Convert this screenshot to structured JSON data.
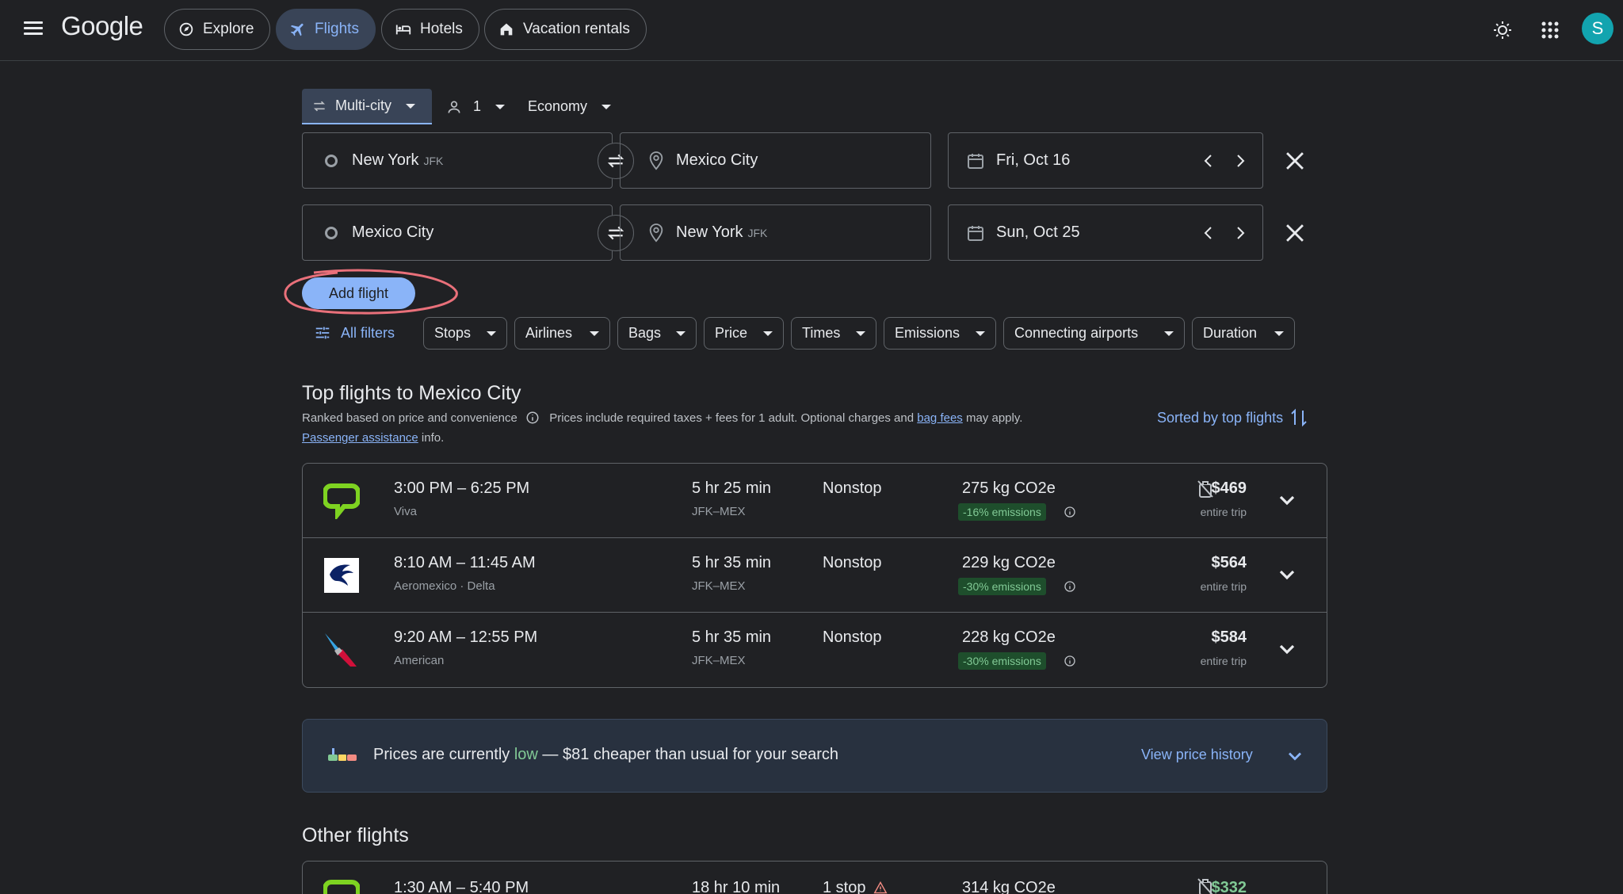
{
  "header": {
    "logo": "Google",
    "nav": [
      {
        "label": "Explore",
        "icon": "explore-icon"
      },
      {
        "label": "Flights",
        "icon": "plane-icon",
        "active": true
      },
      {
        "label": "Hotels",
        "icon": "bed-icon"
      },
      {
        "label": "Vacation rentals",
        "icon": "house-icon"
      }
    ],
    "avatar_initial": "S"
  },
  "search": {
    "trip_type": "Multi-city",
    "passengers": "1",
    "cabin": "Economy",
    "legs": [
      {
        "from": "New York",
        "from_code": "JFK",
        "to": "Mexico City",
        "to_code": "",
        "date": "Fri, Oct 16"
      },
      {
        "from": "Mexico City",
        "from_code": "",
        "to": "New York",
        "to_code": "JFK",
        "date": "Sun, Oct 25"
      }
    ],
    "add_flight": "Add flight"
  },
  "filters": {
    "all": "All filters",
    "chips": [
      "Stops",
      "Airlines",
      "Bags",
      "Price",
      "Times",
      "Emissions",
      "Connecting airports",
      "Duration"
    ]
  },
  "top": {
    "title": "Top flights to Mexico City",
    "ranked": "Ranked based on price and convenience",
    "prices_note": "Prices include required taxes + fees for 1 adult. Optional charges and",
    "bag_fees": "bag fees",
    "may_apply": "may apply.",
    "passenger_assistance": "Passenger assistance",
    "info": "info.",
    "sorted": "Sorted by top flights",
    "flights": [
      {
        "times": "3:00 PM – 6:25 PM",
        "airline": "Viva",
        "duration": "5 hr 25 min",
        "route": "JFK–MEX",
        "stops": "Nonstop",
        "co2": "275 kg CO2e",
        "emissions": "-16% emissions",
        "price": "$469",
        "price_type": "entire trip"
      },
      {
        "times": "8:10 AM – 11:45 AM",
        "airline": "Aeromexico · Delta",
        "duration": "5 hr 35 min",
        "route": "JFK–MEX",
        "stops": "Nonstop",
        "co2": "229 kg CO2e",
        "emissions": "-30% emissions",
        "price": "$564",
        "price_type": "entire trip"
      },
      {
        "times": "9:20 AM – 12:55 PM",
        "airline": "American",
        "duration": "5 hr 35 min",
        "route": "JFK–MEX",
        "stops": "Nonstop",
        "co2": "228 kg CO2e",
        "emissions": "-30% emissions",
        "price": "$584",
        "price_type": "entire trip"
      }
    ]
  },
  "insight": {
    "prefix": "Prices are currently",
    "level": "low",
    "suffix": "— $81 cheaper than usual for your search",
    "link": "View price history"
  },
  "other": {
    "title": "Other flights",
    "first": {
      "times": "1:30 AM – 5:40 PM",
      "duration": "18 hr 10 min",
      "stops": "1 stop",
      "co2": "314 kg CO2e",
      "price": "$332"
    }
  }
}
